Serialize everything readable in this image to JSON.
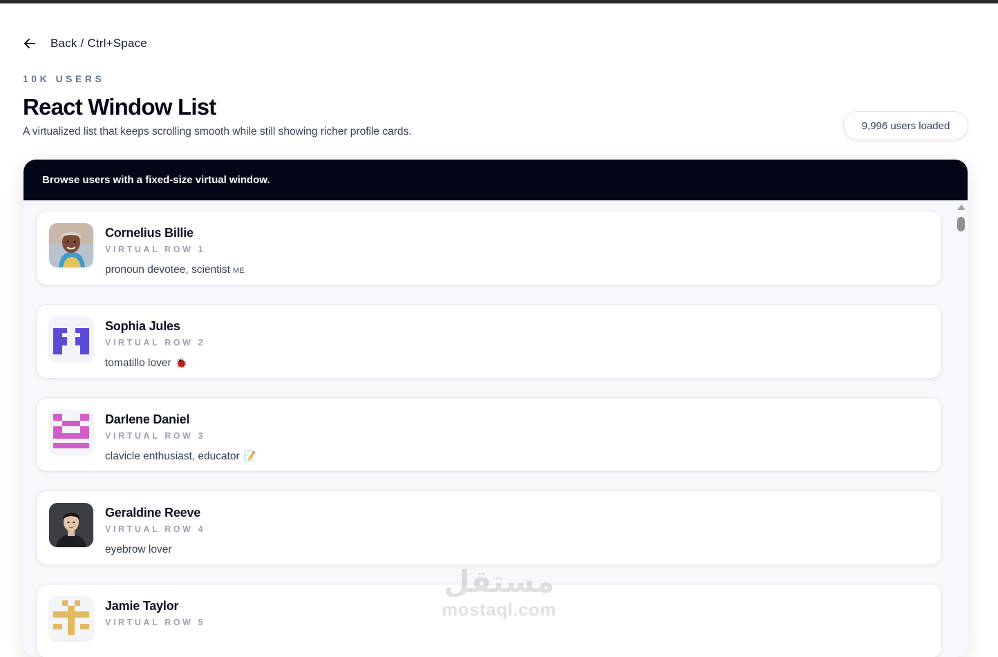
{
  "nav": {
    "back_label": "Back / Ctrl+Space",
    "back_icon": "arrow-left-icon"
  },
  "header": {
    "eyebrow": "10K USERS",
    "title": "React Window List",
    "subtitle": "A virtualized list that keeps scrolling smooth while still showing richer profile cards.",
    "badge": "9,996 users loaded"
  },
  "panel": {
    "heading": "Browse users with a fixed-size virtual window."
  },
  "users": [
    {
      "name": "Cornelius Billie",
      "row": "VIRTUAL ROW 1",
      "bio": "pronoun devotee, scientist",
      "suffix": "ME",
      "emoji": "",
      "avatar": "photo-elderly-woman"
    },
    {
      "name": "Sophia Jules",
      "row": "VIRTUAL ROW 2",
      "bio": "tomatillo lover",
      "suffix": "",
      "emoji": "🐞",
      "avatar": "identicon-indigo"
    },
    {
      "name": "Darlene Daniel",
      "row": "VIRTUAL ROW 3",
      "bio": "clavicle enthusiast, educator",
      "suffix": "",
      "emoji": "📝",
      "avatar": "identicon-magenta"
    },
    {
      "name": "Geraldine Reeve",
      "row": "VIRTUAL ROW 4",
      "bio": "eyebrow lover",
      "suffix": "",
      "emoji": "",
      "avatar": "photo-young-man"
    },
    {
      "name": "Jamie Taylor",
      "row": "VIRTUAL ROW 5",
      "bio": "",
      "suffix": "",
      "emoji": "",
      "avatar": "identicon-gold"
    }
  ],
  "colors": {
    "panel_header_bg": "#030616",
    "identicon_indigo": "#5b4bd6",
    "identicon_magenta": "#cf5fc6",
    "identicon_gold": "#e2b860"
  },
  "watermark": {
    "arabic": "مستقل",
    "latin": "mostaql.com"
  }
}
